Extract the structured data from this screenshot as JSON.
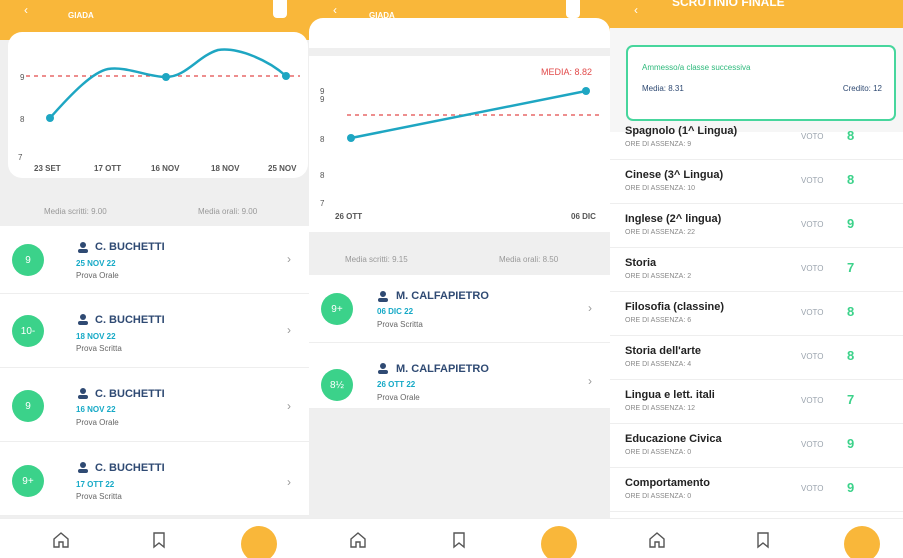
{
  "panel1": {
    "student": "GIADA",
    "chart": {
      "y_ticks": [
        "9",
        "8",
        "7"
      ],
      "x_ticks": [
        "23 SET",
        "17 OTT",
        "16 NOV",
        "18 NOV",
        "25 NOV"
      ]
    },
    "media_scritti": "Media scritti: 9.00",
    "media_orali": "Media orali: 9.00",
    "grades": [
      {
        "grade": "9",
        "teacher": "C. BUCHETTI",
        "date": "25 NOV 22",
        "type": "Prova Orale"
      },
      {
        "grade": "10-",
        "teacher": "C. BUCHETTI",
        "date": "18 NOV 22",
        "type": "Prova Scritta"
      },
      {
        "grade": "9",
        "teacher": "C. BUCHETTI",
        "date": "16 NOV 22",
        "type": "Prova Orale"
      },
      {
        "grade": "9+",
        "teacher": "C. BUCHETTI",
        "date": "17 OTT 22",
        "type": "Prova Scritta"
      }
    ]
  },
  "panel2": {
    "student": "GIADA",
    "chart": {
      "media_label": "MEDIA: 8.82",
      "y_ticks": [
        "9",
        "9",
        "8",
        "8",
        "7"
      ],
      "x_ticks": [
        "26 OTT",
        "06 DIC"
      ]
    },
    "media_scritti": "Media scritti: 9.15",
    "media_orali": "Media orali: 8.50",
    "grades": [
      {
        "grade": "9+",
        "teacher": "M. CALFAPIETRO",
        "date": "06 DIC 22",
        "type": "Prova Scritta"
      },
      {
        "grade": "8½",
        "teacher": "M. CALFAPIETRO",
        "date": "26 OTT 22",
        "type": "Prova Orale"
      }
    ]
  },
  "panel3": {
    "title": "SCRUTINIO FINALE",
    "status": "Ammesso/a classe successiva",
    "media": "Media: 8.31",
    "credito": "Credito: 12",
    "subjects": [
      {
        "name": "Spagnolo (1^ Lingua)",
        "absences": "ORE DI ASSENZA: 9",
        "vote_label": "VOTO",
        "vote": "8"
      },
      {
        "name": "Cinese (3^ Lingua)",
        "absences": "ORE DI ASSENZA: 10",
        "vote_label": "VOTO",
        "vote": "8"
      },
      {
        "name": "Inglese (2^ lingua)",
        "absences": "ORE DI ASSENZA: 22",
        "vote_label": "VOTO",
        "vote": "9"
      },
      {
        "name": "Storia",
        "absences": "ORE DI ASSENZA: 2",
        "vote_label": "VOTO",
        "vote": "7"
      },
      {
        "name": "Filosofia (classine)",
        "absences": "ORE DI ASSENZA: 6",
        "vote_label": "VOTO",
        "vote": "8"
      },
      {
        "name": "Storia dell'arte",
        "absences": "ORE DI ASSENZA: 4",
        "vote_label": "VOTO",
        "vote": "8"
      },
      {
        "name": "Lingua e lett. itali",
        "absences": "ORE DI ASSENZA: 12",
        "vote_label": "VOTO",
        "vote": "7"
      },
      {
        "name": "Educazione Civica",
        "absences": "ORE DI ASSENZA: 0",
        "vote_label": "VOTO",
        "vote": "9"
      },
      {
        "name": "Comportamento",
        "absences": "ORE DI ASSENZA: 0",
        "vote_label": "VOTO",
        "vote": "9"
      }
    ]
  },
  "icons": {
    "home": "home-icon",
    "book": "bookmark-icon",
    "grid": "grid-dots-icon",
    "user": "user-icon",
    "chevron": "chevron-right-icon"
  },
  "colors": {
    "accent": "#f9b73a",
    "green": "#3bd28a",
    "teal": "#15a9c6",
    "navy": "#2f4a73",
    "red_dashed": "#e24a4a"
  }
}
